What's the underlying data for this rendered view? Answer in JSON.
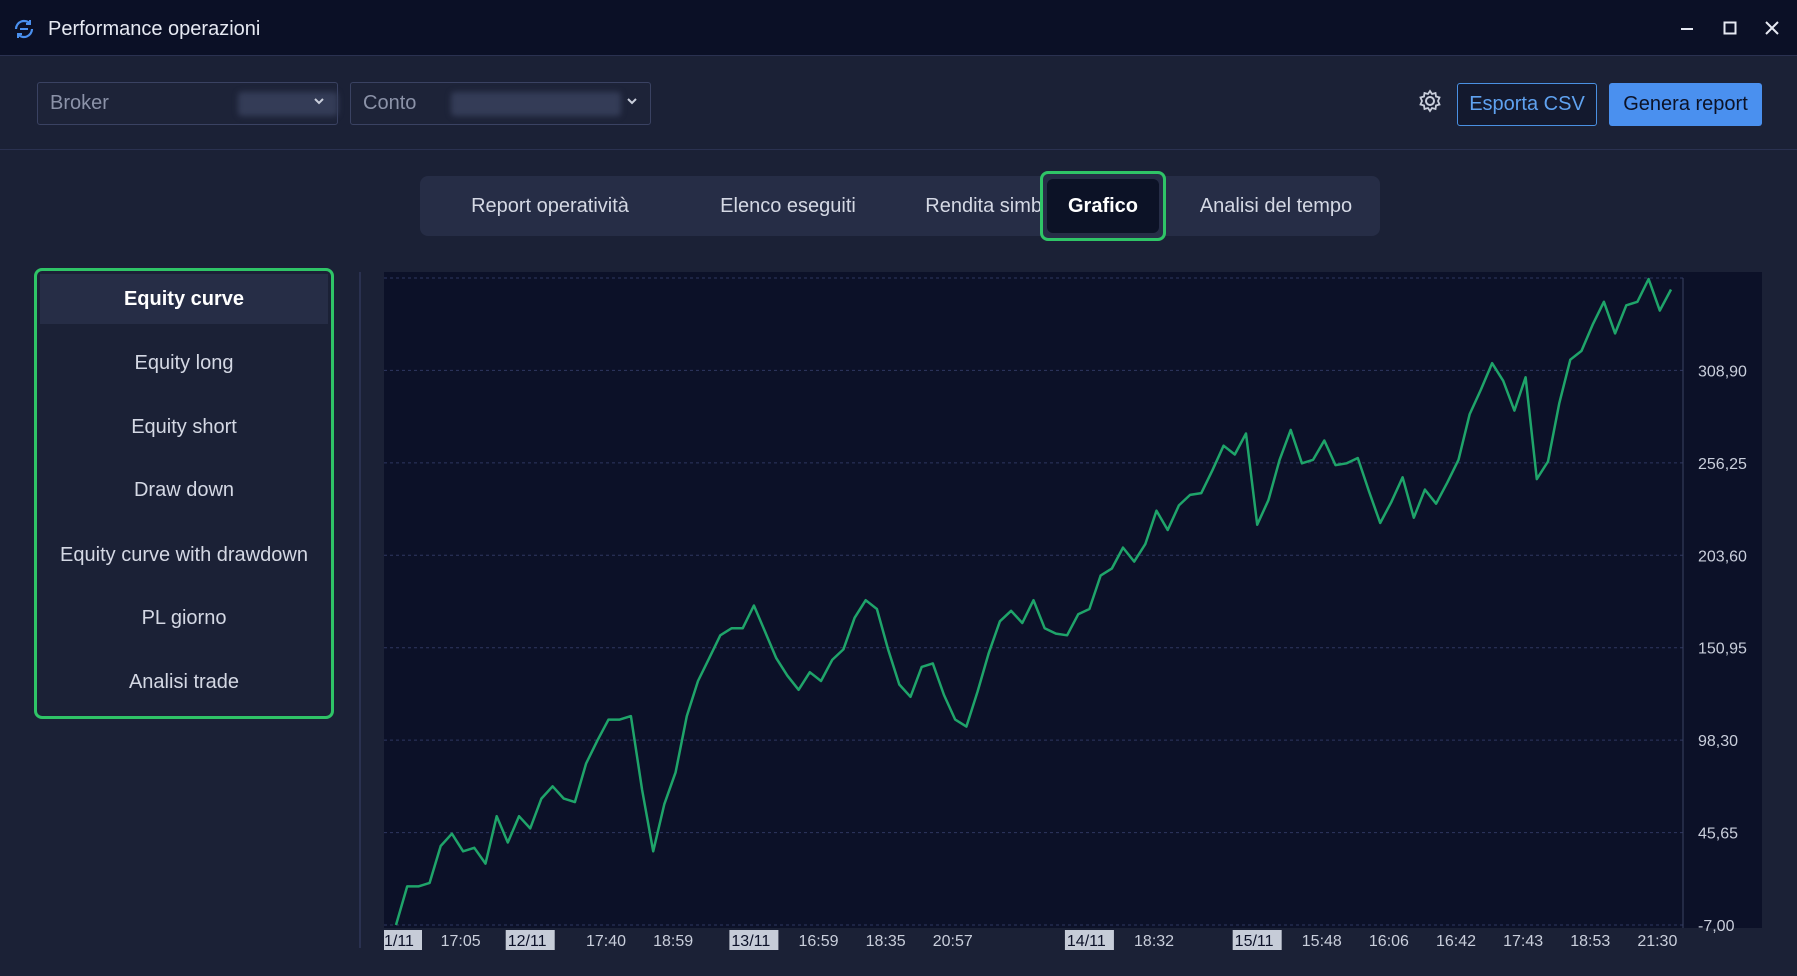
{
  "window": {
    "title": "Performance operazioni",
    "icon": "sync-icon"
  },
  "toolbar": {
    "broker_label": "Broker",
    "conto_label": "Conto",
    "export_label": "Esporta CSV",
    "report_label": "Genera report",
    "settings_icon": "gear-icon"
  },
  "tabs": [
    {
      "label": "Report operatività"
    },
    {
      "label": "Elenco eseguiti"
    },
    {
      "label": "Rendita simbolo"
    },
    {
      "label": "Grafico",
      "active": true
    },
    {
      "label": "Analisi del tempo"
    }
  ],
  "sidebar": {
    "items": [
      {
        "label": "Equity curve",
        "active": true
      },
      {
        "label": "Equity long"
      },
      {
        "label": "Equity short"
      },
      {
        "label": "Draw down"
      },
      {
        "label": "Equity curve with drawdown"
      },
      {
        "label": "PL giorno"
      },
      {
        "label": "Analisi trade"
      }
    ]
  },
  "colors": {
    "accent_green": "#2fc467",
    "line_green": "#1fa46a",
    "blue": "#4a90ef",
    "chart_bg": "#0c1128"
  },
  "chart_data": {
    "type": "line",
    "title": "",
    "xlabel": "",
    "ylabel": "",
    "ylim": [
      -7.0,
      361.55
    ],
    "yticks": [
      "-7,00",
      "45,65",
      "98,30",
      "150,95",
      "203,60",
      "256,25",
      "308,90"
    ],
    "ytick_values": [
      -7.0,
      45.65,
      98.3,
      150.95,
      203.6,
      256.25,
      308.9
    ],
    "xticks": [
      {
        "label": "1/11",
        "date": true,
        "index": 0
      },
      {
        "label": "17:05",
        "index": 6
      },
      {
        "label": "12/11",
        "date": true,
        "index": 12
      },
      {
        "label": "17:40",
        "index": 19
      },
      {
        "label": "18:59",
        "index": 25
      },
      {
        "label": "13/11",
        "date": true,
        "index": 32
      },
      {
        "label": "16:59",
        "index": 38
      },
      {
        "label": "18:35",
        "index": 44
      },
      {
        "label": "20:57",
        "index": 50
      },
      {
        "label": "14/11",
        "date": true,
        "index": 62
      },
      {
        "label": "18:32",
        "index": 68
      },
      {
        "label": "15/11",
        "date": true,
        "index": 77
      },
      {
        "label": "15:48",
        "index": 83
      },
      {
        "label": "16:06",
        "index": 89
      },
      {
        "label": "16:42",
        "index": 95
      },
      {
        "label": "17:43",
        "index": 101
      },
      {
        "label": "18:53",
        "index": 107
      },
      {
        "label": "21:30",
        "index": 113
      }
    ],
    "grid": true,
    "legend": "none",
    "series": [
      {
        "values": [
          -7.0,
          15.0,
          15.0,
          17.0,
          38.0,
          45.0,
          35.0,
          37.0,
          28.0,
          55.0,
          40.0,
          55.0,
          48.0,
          65.0,
          72.0,
          65.0,
          63.0,
          85.0,
          98.0,
          110.0,
          110.0,
          112.0,
          70.0,
          35.0,
          62.0,
          80.0,
          112.0,
          132.0,
          145.0,
          158.0,
          162.0,
          162.0,
          175.0,
          160.0,
          145.0,
          135.0,
          127.0,
          137.0,
          132.0,
          144.0,
          150.0,
          168.0,
          178.0,
          173.0,
          150.0,
          130.0,
          123.0,
          140.0,
          142.0,
          124.0,
          110.0,
          106.0,
          126.0,
          148.0,
          166.0,
          172.0,
          165.0,
          178.0,
          162.0,
          159.0,
          158.0,
          170.0,
          173.0,
          192.0,
          196.0,
          208.0,
          200.0,
          210.0,
          229.0,
          218.0,
          232.0,
          238.0,
          239.0,
          252.0,
          266.0,
          261.0,
          273.0,
          221.0,
          235.0,
          258.0,
          275.0,
          256.0,
          258.0,
          269.0,
          255.0,
          256.0,
          259.0,
          240.0,
          222.0,
          234.0,
          248.0,
          225.0,
          241.0,
          233.0,
          245.0,
          258.0,
          284.0,
          298.0,
          313.0,
          303.0,
          286.0,
          305.0,
          247.0,
          257.0,
          290.0,
          315.0,
          320.0,
          335.0,
          348.0,
          330.0,
          346.0,
          348.0,
          361.0,
          343.0,
          355.0
        ]
      }
    ]
  }
}
